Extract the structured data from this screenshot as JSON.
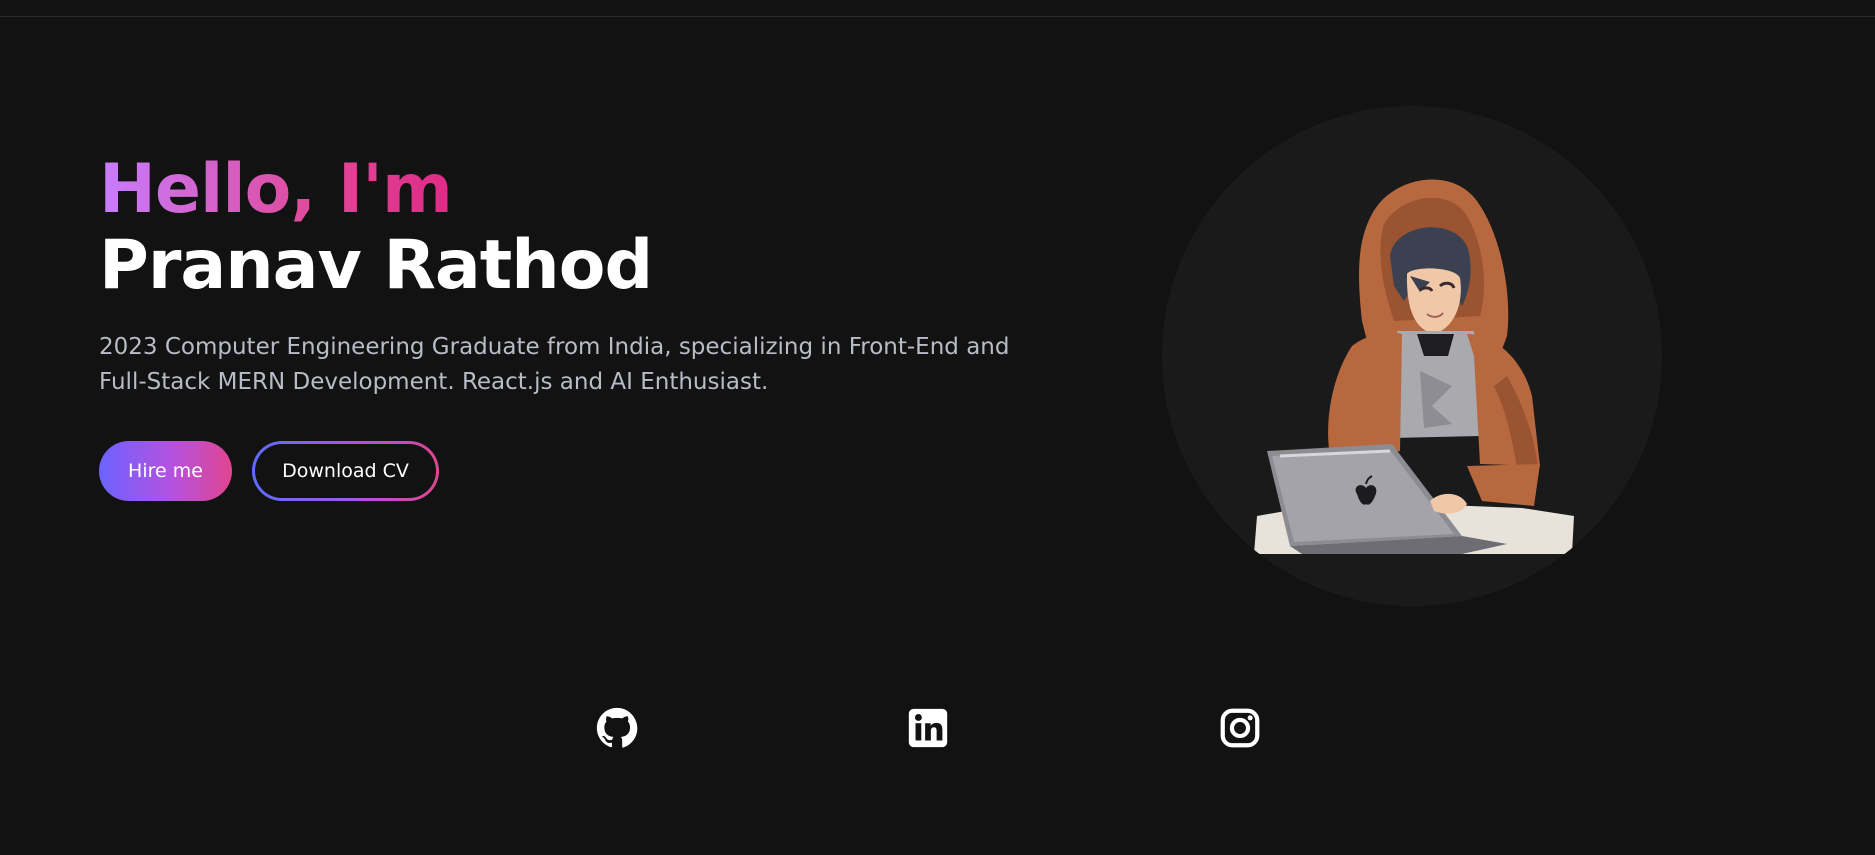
{
  "hero": {
    "greeting": "Hello, I'm",
    "name": "Pranav Rathod",
    "bio": "2023 Computer Engineering Graduate from India, specializing in Front-End and Full-Stack MERN Development. React.js and AI Enthusiast."
  },
  "buttons": {
    "hire_label": "Hire me",
    "cv_label": "Download CV"
  },
  "avatar": {
    "icon": "avatar-illustration"
  },
  "socials": [
    {
      "icon": "github-icon"
    },
    {
      "icon": "linkedin-icon"
    },
    {
      "icon": "instagram-icon"
    }
  ],
  "colors": {
    "background": "#121212",
    "accent_start": "#6c63ff",
    "accent_mid": "#b452e0",
    "accent_end": "#e0458f",
    "greeting_start": "#c77dff",
    "greeting_end": "#e02a86"
  }
}
